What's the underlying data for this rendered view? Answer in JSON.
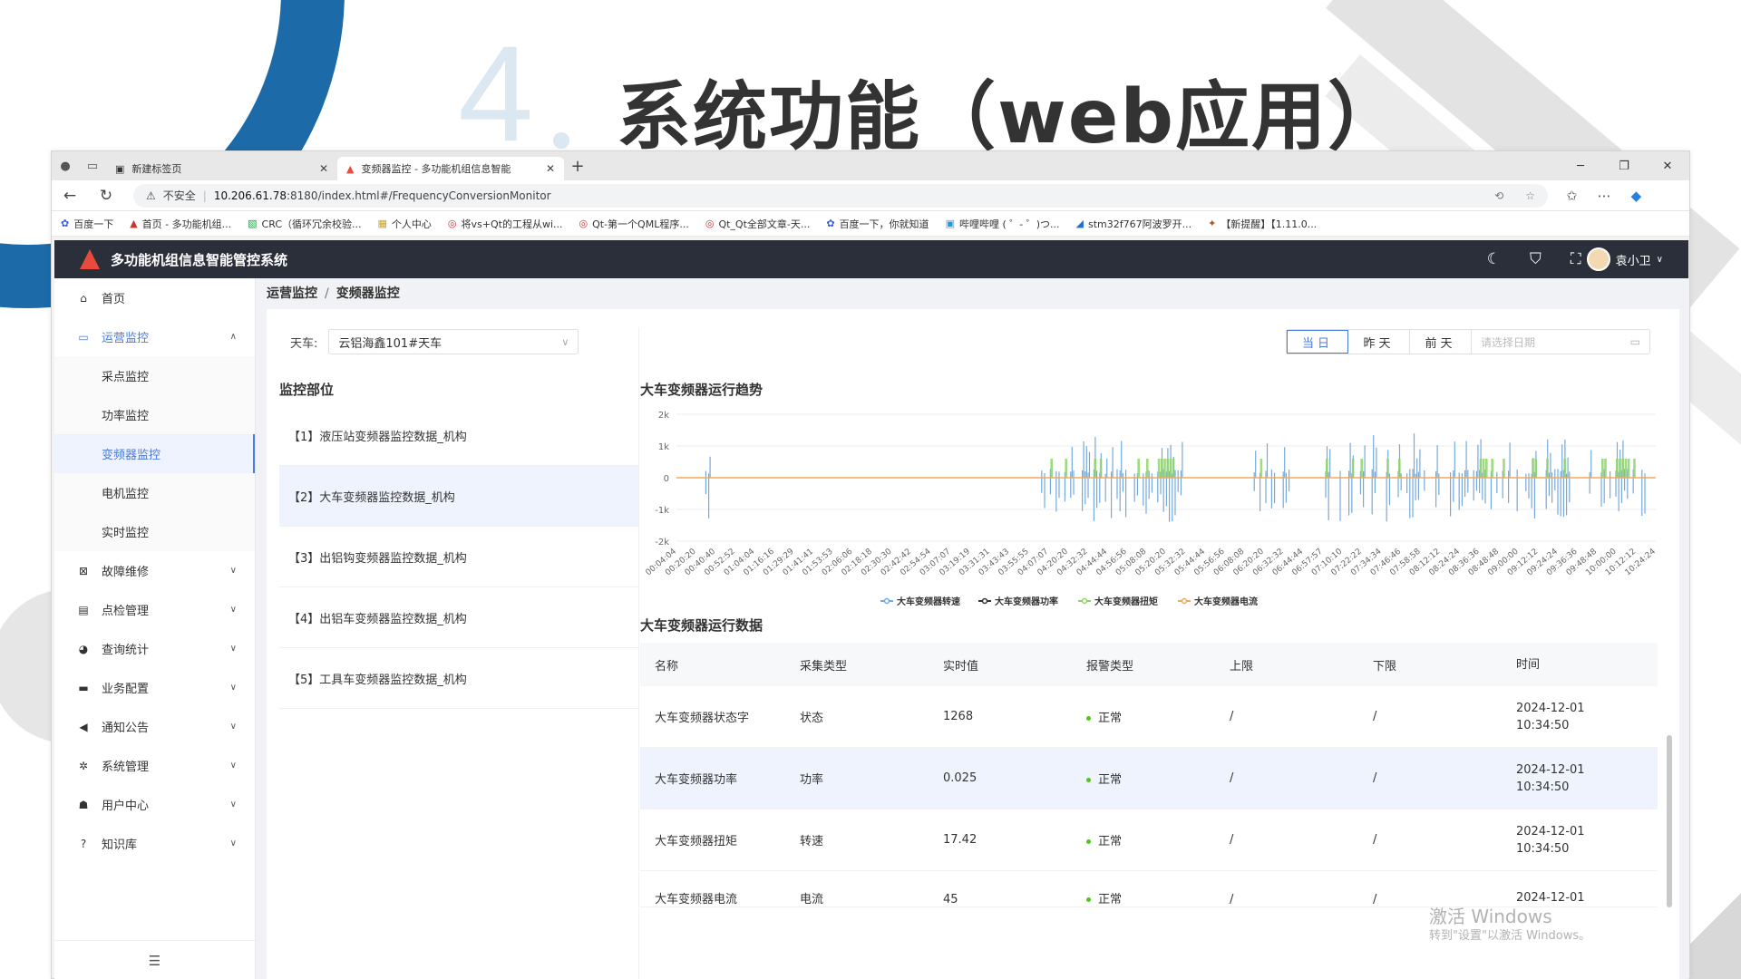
{
  "slide": {
    "number": "4",
    "title": "系统功能（web应用）"
  },
  "browser": {
    "tabs": [
      {
        "label": "新建标签页"
      },
      {
        "label": "变频器监控 - 多功能机组信息智能"
      }
    ],
    "url_warning": "不安全",
    "url_host": "10.206.61.78",
    "url_rest": ":8180/index.html#/FrequencyConversionMonitor",
    "bookmarks": [
      "百度一下",
      "首页 - 多功能机组...",
      "CRC（循环冗余校验...",
      "个人中心",
      "将vs+Qt的工程从wi...",
      "Qt-第一个QML程序...",
      "Qt_Qt全部文章-天...",
      "百度一下，你就知道",
      "哔哩哔哩 ( ゜- ゜)つ...",
      "stm32f767阿波罗开...",
      "【新提醒】【1.11.0..."
    ]
  },
  "app": {
    "title": "多功能机组信息智能管控系统",
    "user": "袁小卫",
    "menu": [
      {
        "label": "首页",
        "icon": "home-icon"
      },
      {
        "label": "运营监控",
        "icon": "monitor-icon",
        "open": true,
        "children": [
          "采点监控",
          "功率监控",
          "变频器监控",
          "电机监控",
          "实时监控"
        ]
      },
      {
        "label": "故障维修",
        "icon": "repair-icon"
      },
      {
        "label": "点检管理",
        "icon": "inspect-icon"
      },
      {
        "label": "查询统计",
        "icon": "stats-icon"
      },
      {
        "label": "业务配置",
        "icon": "briefcase-icon"
      },
      {
        "label": "通知公告",
        "icon": "megaphone-icon"
      },
      {
        "label": "系统管理",
        "icon": "gear-icon"
      },
      {
        "label": "用户中心",
        "icon": "users-icon"
      },
      {
        "label": "知识库",
        "icon": "help-icon"
      }
    ],
    "breadcrumb": [
      "运营监控",
      "变频器监控"
    ],
    "filter": {
      "label": "天车:",
      "value": "云铝海鑫101#天车"
    },
    "date_buttons": [
      "当日",
      "昨天",
      "前天"
    ],
    "date_placeholder": "请选择日期",
    "parts_title": "监控部位",
    "parts": [
      "【1】液压站变频器监控数据_机构",
      "【2】大车变频器监控数据_机构",
      "【3】出铝钩变频器监控数据_机构",
      "【4】出铝车变频器监控数据_机构",
      "【5】工具车变频器监控数据_机构"
    ],
    "chart_title": "大车变频器运行趋势",
    "table_title": "大车变频器运行数据",
    "table": {
      "headers": [
        "名称",
        "采集类型",
        "实时值",
        "报警类型",
        "上限",
        "下限",
        "时间"
      ],
      "rows": [
        [
          "大车变频器状态字",
          "状态",
          "1268",
          "正常",
          "/",
          "/",
          "2024-12-01",
          "10:34:50"
        ],
        [
          "大车变频器功率",
          "功率",
          "0.025",
          "正常",
          "/",
          "/",
          "2024-12-01",
          "10:34:50"
        ],
        [
          "大车变频器扭矩",
          "转速",
          "17.42",
          "正常",
          "/",
          "/",
          "2024-12-01",
          "10:34:50"
        ],
        [
          "大车变频器电流",
          "电流",
          "45",
          "正常",
          "/",
          "/",
          "2024-12-01",
          ""
        ]
      ]
    },
    "watermark": [
      "激活 Windows",
      "转到\"设置\"以激活 Windows。"
    ]
  },
  "chart_data": {
    "type": "line",
    "title": "大车变频器运行趋势",
    "ylim": [
      -2000,
      2000
    ],
    "yticks": [
      "2k",
      "1k",
      "0",
      "-1k",
      "-2k"
    ],
    "x": [
      "00:04:04",
      "00:20:20",
      "00:40:40",
      "00:52:52",
      "01:04:04",
      "01:16:16",
      "01:29:29",
      "01:41:41",
      "01:53:53",
      "02:06:06",
      "02:18:18",
      "02:30:30",
      "02:42:42",
      "02:54:54",
      "03:07:07",
      "03:19:19",
      "03:31:31",
      "03:43:43",
      "03:55:55",
      "04:07:07",
      "04:20:20",
      "04:32:32",
      "04:44:44",
      "04:56:56",
      "05:08:08",
      "05:20:20",
      "05:32:32",
      "05:44:44",
      "05:56:56",
      "06:08:08",
      "06:20:20",
      "06:32:32",
      "06:44:44",
      "06:57:57",
      "07:10:10",
      "07:22:22",
      "07:34:34",
      "07:46:46",
      "07:58:58",
      "08:12:12",
      "08:24:24",
      "08:36:36",
      "08:48:48",
      "09:00:00",
      "09:12:12",
      "09:24:24",
      "09:36:36",
      "09:48:48",
      "10:00:00",
      "10:12:12",
      "10:24:24"
    ],
    "series": [
      {
        "name": "大车变频器转速",
        "color": "#73a9e0"
      },
      {
        "name": "大车变频器功率",
        "color": "#333333"
      },
      {
        "name": "大车变频器扭矩",
        "color": "#8fd36b"
      },
      {
        "name": "大车变频器电流",
        "color": "#f0a95c"
      }
    ],
    "activity_windows": [
      [
        0.03,
        0.035
      ],
      [
        0.37,
        0.52
      ],
      [
        0.59,
        0.63
      ],
      [
        0.66,
        0.99
      ]
    ],
    "legend": "bottom"
  }
}
